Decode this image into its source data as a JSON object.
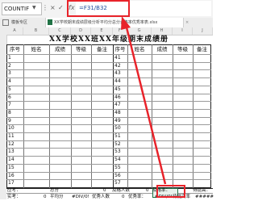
{
  "formula_bar": {
    "name_box": "COUNTIF",
    "cancel_icon": "×",
    "enter_icon": "✓",
    "fx_label": "fx",
    "formula": "=F31/B32"
  },
  "tabs": {
    "tab1": "模板专区",
    "tab2": "XX学校期末成绩层级分析平均分总分合格率优秀率表.xlsx"
  },
  "columns": [
    "A",
    "B",
    "C",
    "D",
    "E",
    "F",
    "G",
    "H",
    "I",
    "J"
  ],
  "sheet": {
    "title": "XX学校XX班XX年级期末成绩册",
    "headers": [
      "序号",
      "姓名",
      "成绩",
      "等级",
      "备注",
      "序号",
      "姓名",
      "成绩",
      "等级",
      "备注"
    ],
    "left_rows": [
      "1",
      "2",
      "3",
      "4",
      "5",
      "6",
      "7",
      "8",
      "9",
      "10",
      "11",
      "12",
      "13",
      "14",
      "15",
      "16",
      "17"
    ],
    "right_rows": [
      "41",
      "42",
      "43",
      "44",
      "45",
      "46",
      "47",
      "48",
      "49",
      "50",
      "51",
      "52",
      "53",
      "54",
      "55",
      "56",
      "57"
    ]
  },
  "summary": {
    "row1": [
      "应考：",
      "总分",
      "0",
      "及格人数",
      "0",
      "及格率：",
      "",
      "待提高："
    ],
    "row2": [
      "实考：",
      "0",
      "平均分",
      "#DIV/0!",
      "优秀人数",
      "0",
      "优秀率：",
      "#DIV/0!",
      "待提高率",
      "#####"
    ]
  }
}
